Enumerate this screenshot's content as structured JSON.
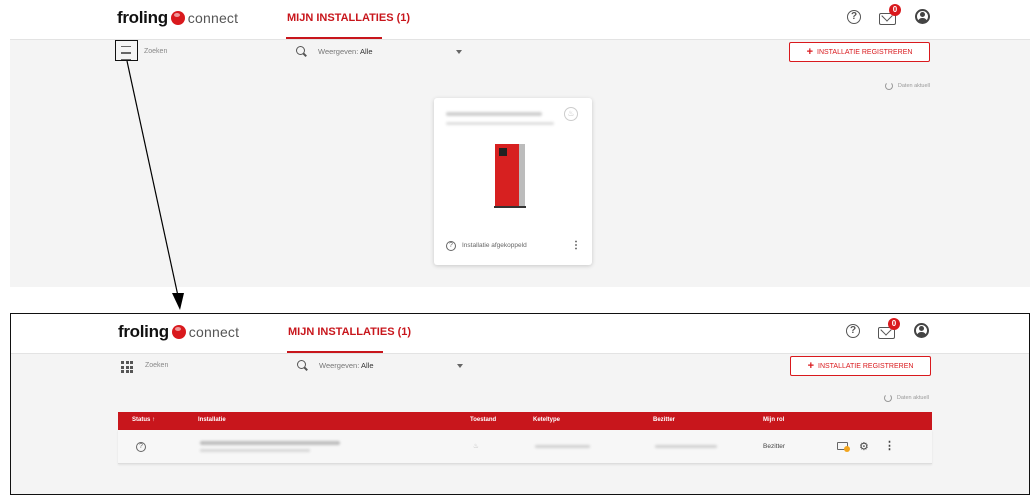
{
  "brand": {
    "name": "froling",
    "suffix": "connect",
    "accent": "#d9191d"
  },
  "nav": {
    "active_tab": "MIJN INSTALLATIES (1)"
  },
  "header": {
    "notification_count": "0"
  },
  "toolbar": {
    "search_placeholder": "Zoeken",
    "filter_label": "Weergeven:",
    "filter_value": "Alle",
    "register_button": "INSTALLATIE REGISTREREN",
    "refresh_label": "Daten aktuell"
  },
  "card": {
    "status": "Installatie afgekoppeld"
  },
  "table": {
    "columns": [
      "Status",
      "Installatie",
      "Toestand",
      "Keteltype",
      "Bezitter",
      "Mijn rol"
    ],
    "sort_indicator": "↑",
    "rows": [
      {
        "role": "Bezitter"
      }
    ]
  },
  "icons": [
    "view-list-icon",
    "view-grid-icon",
    "search-icon",
    "help-icon",
    "mail-icon",
    "user-icon",
    "refresh-icon",
    "flame-icon",
    "gear-icon",
    "more-vert-icon"
  ]
}
